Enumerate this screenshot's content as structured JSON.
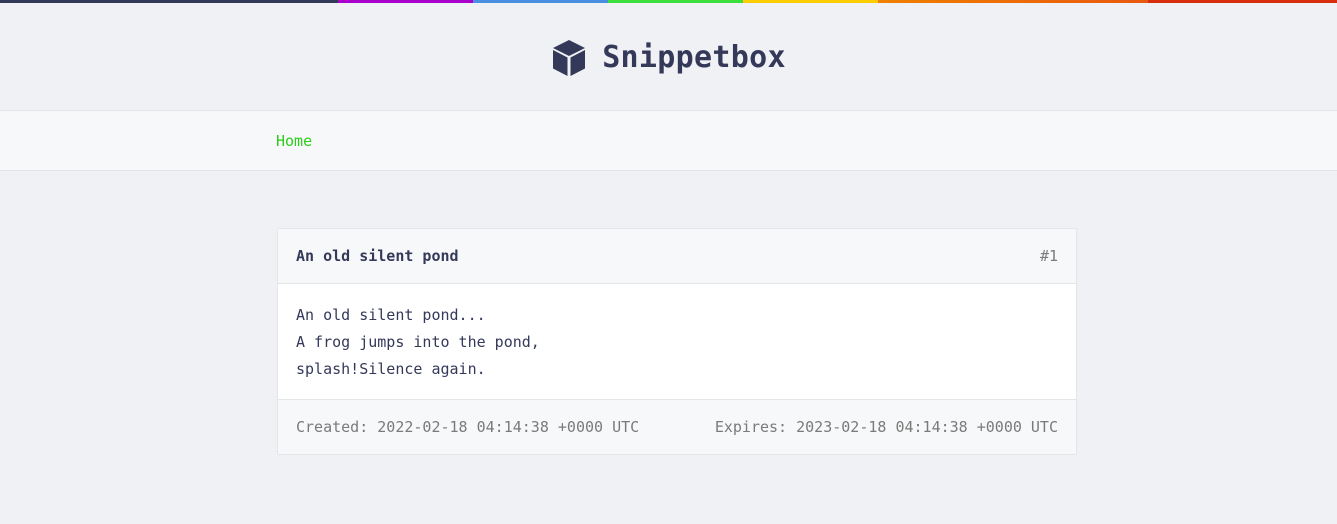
{
  "colors": {
    "rainbow": [
      "#34395a",
      "#34395a",
      "#aa00cc",
      "#4a90e2",
      "#3ce03c",
      "#ffcc00",
      "#f08000",
      "#d82e0e"
    ]
  },
  "header": {
    "logo_icon": "cube-icon",
    "brand_name": "Snippetbox"
  },
  "nav": {
    "home_label": "Home"
  },
  "snippet": {
    "title": "An old silent pond",
    "id_label": "#1",
    "content": "An old silent pond...\nA frog jumps into the pond,\nsplash!Silence again.",
    "created": "Created: 2022-02-18 04:14:38 +0000 UTC",
    "expires": "Expires: 2023-02-18 04:14:38 +0000 UTC"
  }
}
